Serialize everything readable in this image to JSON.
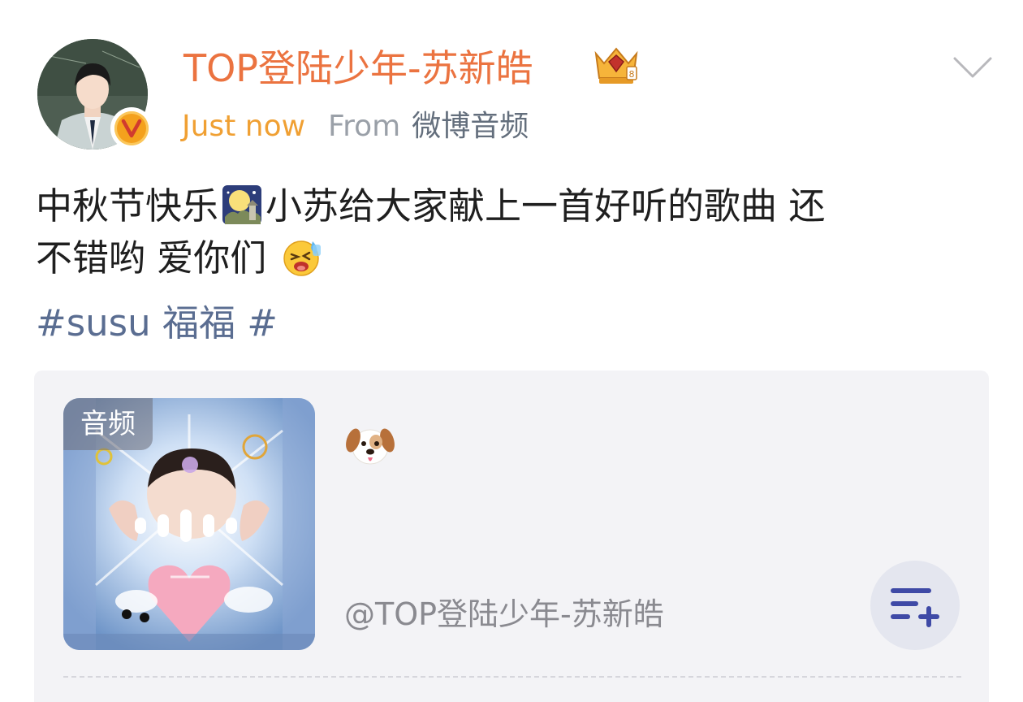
{
  "post": {
    "author": {
      "name": "TOP登陆少年-苏新皓",
      "avatar_icon": "avatar-photo",
      "verified_icon": "verified-v-icon",
      "vip_icon": "crown-icon"
    },
    "time": "Just now",
    "from_label": "From",
    "source": "微博音频",
    "text_line1_a": "中秋节快乐",
    "text_line1_b": "小苏给大家献上一首好听的歌曲 还",
    "text_line2": "不错哟 爱你们",
    "emoji_1": "moon-festival-emoji",
    "emoji_2": "laughing-tears-emoji",
    "hashtag": "#susu 福福 #"
  },
  "audio_card": {
    "tag": "音频",
    "title_emoji": "dog-emoji",
    "author": "@TOP登陆少年-苏新皓",
    "add_icon": "add-to-playlist-icon"
  },
  "colors": {
    "username": "#eb7340",
    "time": "#f0a033",
    "hashtag": "#5a6d91",
    "card_bg": "#f3f3f6"
  }
}
